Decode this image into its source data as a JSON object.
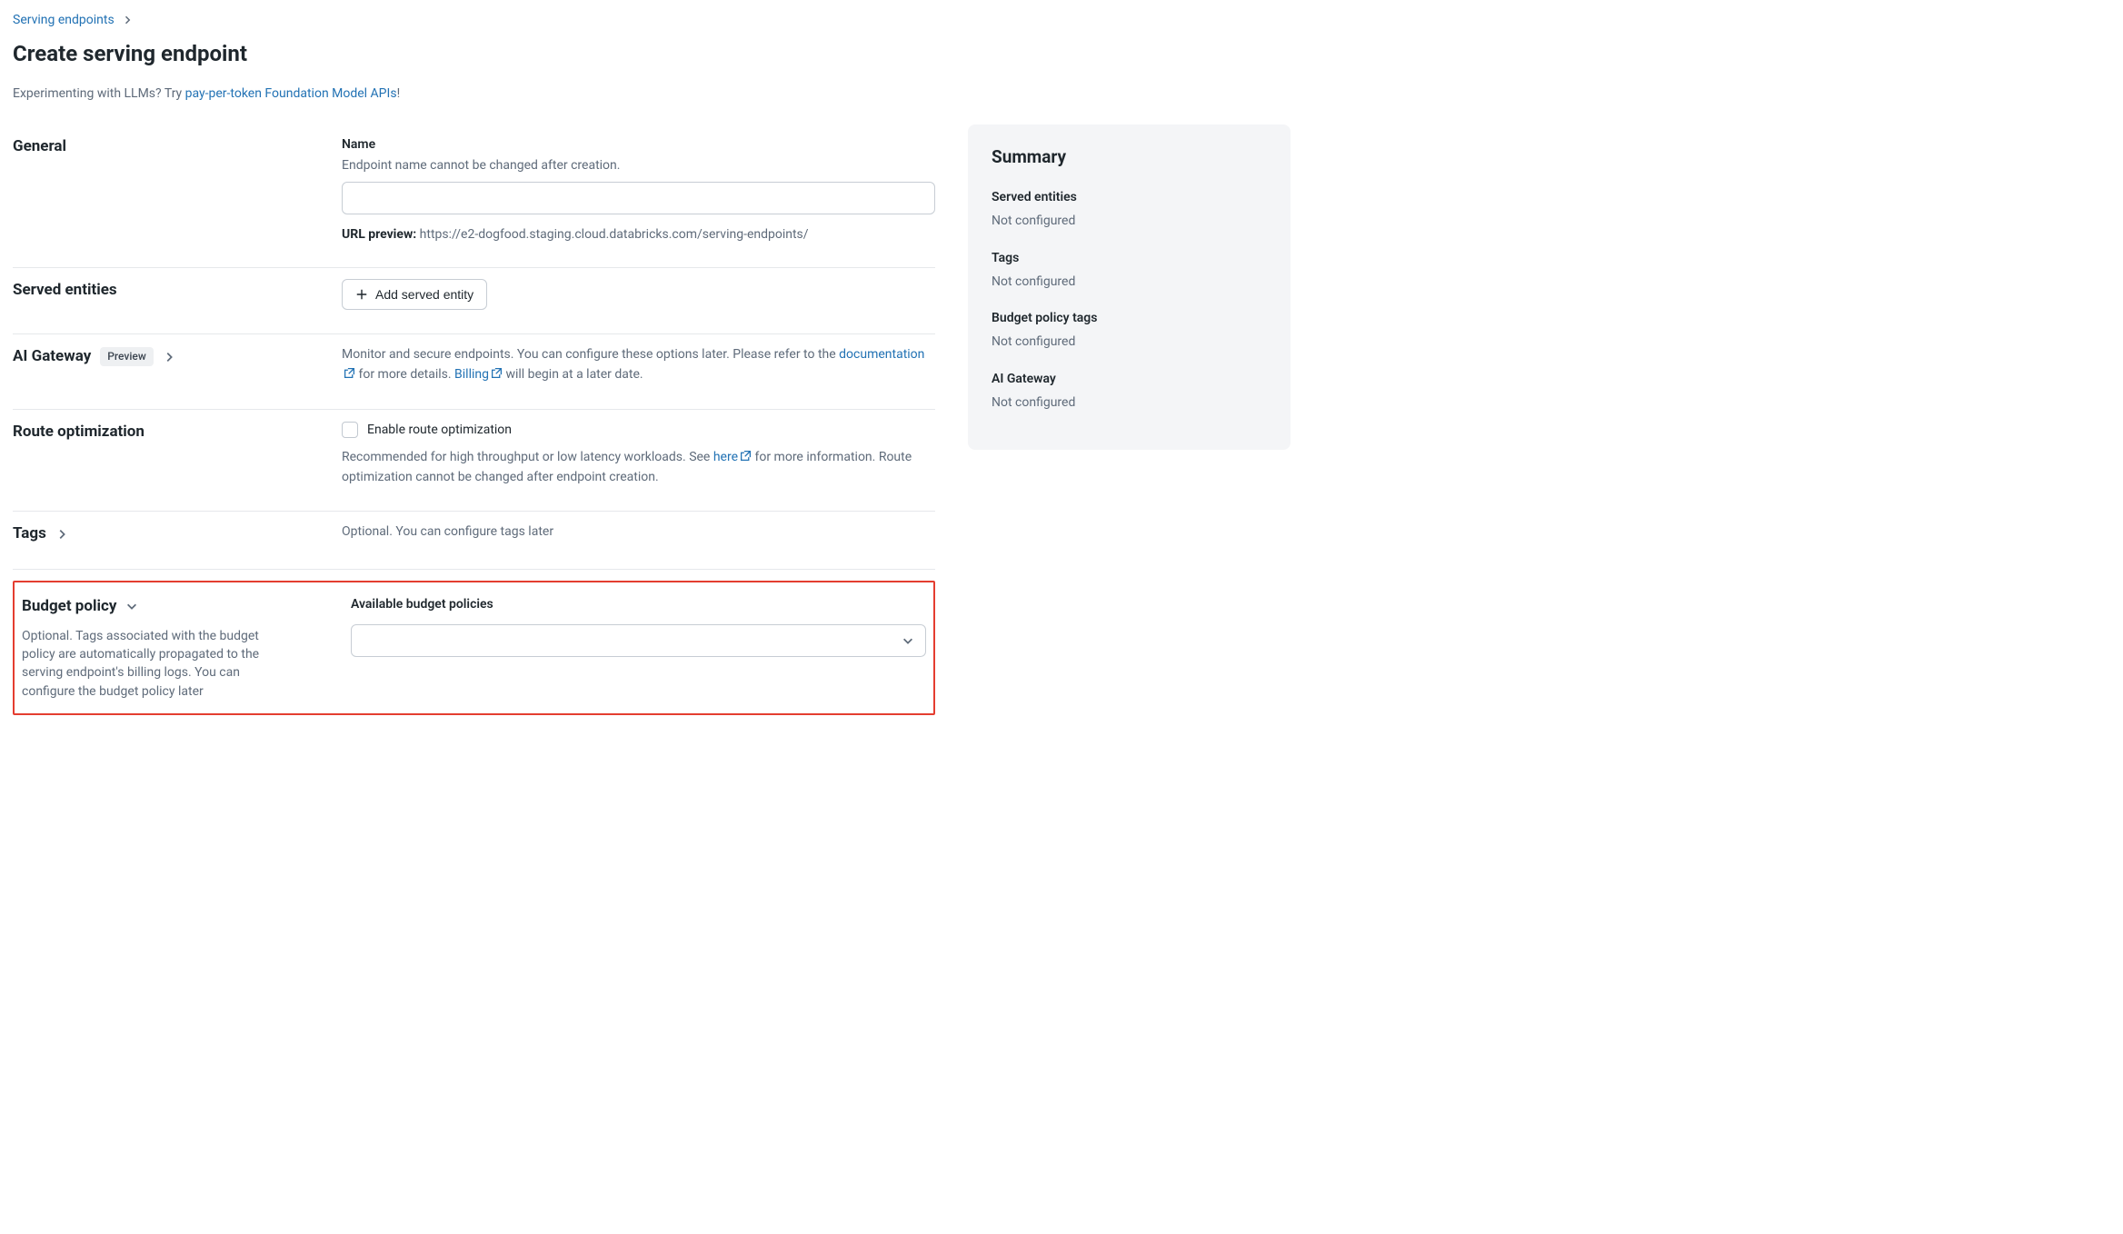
{
  "breadcrumb": {
    "parent": "Serving endpoints"
  },
  "page_title": "Create serving endpoint",
  "llm_hint": {
    "prefix": "Experimenting with LLMs? Try ",
    "link": "pay-per-token Foundation Model APIs",
    "suffix": "!"
  },
  "general": {
    "heading": "General",
    "name_label": "Name",
    "name_hint": "Endpoint name cannot be changed after creation.",
    "name_value": "",
    "url_preview_label": "URL preview:",
    "url_preview_value": "https://e2-dogfood.staging.cloud.databricks.com/serving-endpoints/"
  },
  "served_entities": {
    "heading": "Served entities",
    "add_button": "Add served entity"
  },
  "ai_gateway": {
    "heading": "AI Gateway",
    "badge": "Preview",
    "desc_prefix": "Monitor and secure endpoints. You can configure these options later. Please refer to the ",
    "doc_link": "documentation",
    "desc_mid": " for more details. ",
    "billing_link": "Billing",
    "desc_suffix": " will begin at a later date."
  },
  "route_opt": {
    "heading": "Route optimization",
    "checkbox_label": "Enable route optimization",
    "hint_prefix": "Recommended for high throughput or low latency workloads. See ",
    "hint_link": "here",
    "hint_suffix": " for more information. Route optimization cannot be changed after endpoint creation."
  },
  "tags": {
    "heading": "Tags",
    "hint": "Optional. You can configure tags later"
  },
  "budget_policy": {
    "heading": "Budget policy",
    "desc": "Optional. Tags associated with the budget policy are automatically propagated to the serving endpoint's billing logs. You can configure the budget policy later",
    "field_label": "Available budget policies"
  },
  "summary": {
    "heading": "Summary",
    "items": [
      {
        "label": "Served entities",
        "value": "Not configured"
      },
      {
        "label": "Tags",
        "value": "Not configured"
      },
      {
        "label": "Budget policy tags",
        "value": "Not configured"
      },
      {
        "label": "AI Gateway",
        "value": "Not configured"
      }
    ]
  }
}
